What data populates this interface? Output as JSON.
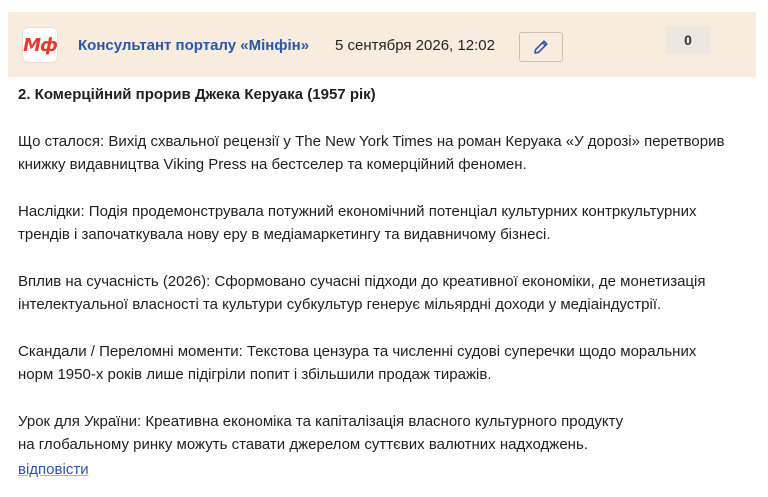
{
  "header": {
    "logo_text": "Мф",
    "author": "Консультант порталу «Мінфін»",
    "date": "5 сентября 2026, 12:02",
    "edit_icon": "pencil-icon",
    "counter": "0"
  },
  "post": {
    "title": "2. Комерційний прорив Джека Керуака (1957 рік)",
    "paragraphs": [
      [
        "Що сталося: Вихід схвальної рецензії у The New York Times на роман Керуака «У дорозі» перетворив",
        "книжку видавництва Viking Press на бестселер та комерційний феномен."
      ],
      [
        "Наслідки: Подія продемонструвала потужний економічний потенціал культурних контркультурних",
        "трендів і започаткувала нову еру в медіамаркетингу та видавничому бізнесі."
      ],
      [
        "Вплив на сучасність (2026): Сформовано сучасні підходи до креативної економіки, де монетизація",
        "інтелектуальної власності та культури субкультур генерує мільярдні доходи у медіаіндустрії."
      ],
      [
        "Скандали / Переломні моменти: Текстова цензура та численні судові суперечки щодо моральних",
        "норм 1950-х років лише підігріли попит і збільшили продаж тиражів."
      ],
      [
        "Урок для України: Креативна економіка та капіталізація власного культурного продукту",
        "на глобальному ринку можуть ставати джерелом суттєвих валютних надходжень."
      ]
    ],
    "reply_label": "відповісти"
  },
  "colors": {
    "header_bg": "#f8ecdf",
    "logo_red": "#e33b2e",
    "link_blue": "#2a55a8"
  }
}
